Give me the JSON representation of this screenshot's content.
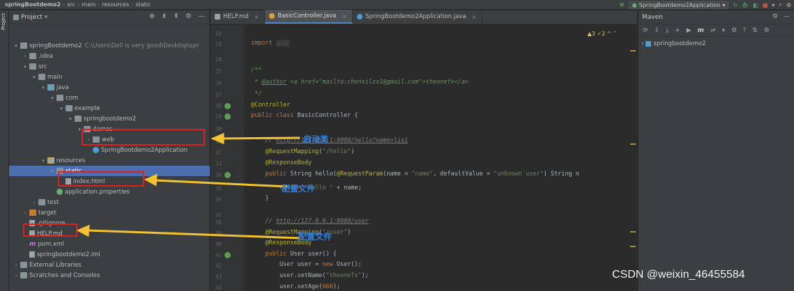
{
  "breadcrumb": [
    "springBootdemo2",
    "src",
    "main",
    "resources",
    "static"
  ],
  "run_config": "SpringBootdemo2Application",
  "left_strip_label": "Project",
  "project_panel": {
    "title": "Project",
    "tree": [
      {
        "label": "springBootdemo2",
        "hint": "C:\\Users\\Dell is very good\\Desktop\\spr",
        "arrow": "▾",
        "icon": "folder",
        "indent": 0
      },
      {
        "label": ".idea",
        "arrow": "›",
        "icon": "folder",
        "indent": 1
      },
      {
        "label": "src",
        "arrow": "▾",
        "icon": "folder",
        "indent": 1
      },
      {
        "label": "main",
        "arrow": "▾",
        "icon": "folder",
        "indent": 2
      },
      {
        "label": "java",
        "arrow": "▾",
        "icon": "folder-src",
        "indent": 3
      },
      {
        "label": "com",
        "arrow": "▾",
        "icon": "folder",
        "indent": 4
      },
      {
        "label": "example",
        "arrow": "▾",
        "icon": "folder",
        "indent": 5
      },
      {
        "label": "springbootdemo2",
        "arrow": "▾",
        "icon": "folder",
        "indent": 6
      },
      {
        "label": "demos",
        "arrow": "▾",
        "icon": "folder",
        "indent": 7
      },
      {
        "label": "web",
        "arrow": "›",
        "icon": "folder",
        "indent": 8
      },
      {
        "label": "SpringBootdemo2Application",
        "arrow": "",
        "icon": "app",
        "indent": 8
      },
      {
        "label": "resources",
        "arrow": "▾",
        "icon": "folder-res",
        "indent": 3
      },
      {
        "label": "static",
        "arrow": "▾",
        "icon": "folder",
        "indent": 4,
        "selected": true
      },
      {
        "label": "index.html",
        "arrow": "",
        "icon": "file",
        "indent": 5
      },
      {
        "label": "application.properties",
        "arrow": "",
        "icon": "spring",
        "indent": 4
      },
      {
        "label": "test",
        "arrow": "›",
        "icon": "folder",
        "indent": 2
      },
      {
        "label": "target",
        "arrow": "›",
        "icon": "folder-target",
        "indent": 1
      },
      {
        "label": ".gitignore",
        "arrow": "",
        "icon": "file",
        "indent": 1
      },
      {
        "label": "HELP.md",
        "arrow": "",
        "icon": "file",
        "indent": 1
      },
      {
        "label": "pom.xml",
        "arrow": "",
        "icon": "xml",
        "indent": 1
      },
      {
        "label": "springbootdemo2.iml",
        "arrow": "",
        "icon": "file",
        "indent": 1
      },
      {
        "label": "External Libraries",
        "arrow": "›",
        "icon": "folder",
        "indent": 0
      },
      {
        "label": "Scratches and Consoles",
        "arrow": "›",
        "icon": "folder",
        "indent": 0
      }
    ]
  },
  "editor": {
    "tabs": [
      {
        "label": "HELP.md",
        "active": false
      },
      {
        "label": "BasicController.java",
        "active": true
      },
      {
        "label": "SpringBootdemo2Application.java",
        "active": false
      }
    ],
    "inspection": "▲3  ✓2  ^  ˅",
    "lines": [
      {
        "num": "18",
        "html": ""
      },
      {
        "num": "19",
        "html": "<span class=\"kw\">import</span> <span class=\"fold\">...</span>"
      },
      {
        "num": "24",
        "html": ""
      },
      {
        "num": "25",
        "html": "<span class=\"cmt\">/**</span>"
      },
      {
        "num": "26",
        "html": "<span class=\"cmt\"> * <u>@author</u> &lt;a href=\"mailto:chenxilzx1@gmail.com\"&gt;theonefx&lt;/a&gt;</span>"
      },
      {
        "num": "27",
        "html": "<span class=\"cmt\"> */</span>"
      },
      {
        "num": "28",
        "html": "<span class=\"ann\">@Controller</span>"
      },
      {
        "num": "29",
        "html": "<span class=\"kw\">public class</span> BasicController {"
      },
      {
        "num": "30",
        "html": ""
      },
      {
        "num": "31",
        "html": "    <span class=\"cmt\">// <span class=\"lnk\">http://127.0.0.1:8080/hello?name=lisi</span></span>"
      },
      {
        "num": "32",
        "html": "    <span class=\"ann\">@RequestMapping</span>(<span class=\"str\">\"/hello\"</span>)"
      },
      {
        "num": "33",
        "html": "    <span class=\"ann\">@ResponseBody</span>"
      },
      {
        "num": "34",
        "html": "    <span class=\"kw\">public</span> String hello(<span class=\"ann\">@RequestParam</span>(name = <span class=\"str\">\"name\"</span>, defaultValue = <span class=\"str\">\"unknown user\"</span>) String n"
      },
      {
        "num": "35",
        "html": "        <span class=\"kw\">return</span> <span class=\"str\">\"Hello \"</span> + name;"
      },
      {
        "num": "36",
        "html": "    }"
      },
      {
        "num": "37",
        "html": ""
      },
      {
        "num": "38",
        "html": "    <span class=\"cmt\">// <span class=\"lnk\">http://127.0.0.1:8080/user</span></span>"
      },
      {
        "num": "39",
        "html": "    <span class=\"ann\">@RequestMapping</span>(<span class=\"str\">\"/user\"</span>)"
      },
      {
        "num": "40",
        "html": "    <span class=\"ann\">@ResponseBody</span>"
      },
      {
        "num": "41",
        "html": "    <span class=\"kw\">public</span> User user() {"
      },
      {
        "num": "42",
        "html": "        User user = <span class=\"kw\">new</span> User();"
      },
      {
        "num": "43",
        "html": "        user.setName(<span class=\"str\">\"theonefx\"</span>);"
      },
      {
        "num": "44",
        "html": "        user.setAge(<span class=\"kw\">666</span>);"
      }
    ]
  },
  "annotations": [
    {
      "label": "启动类"
    },
    {
      "label": "配置文件"
    },
    {
      "label": "配置文件"
    }
  ],
  "maven": {
    "title": "Maven",
    "toolbar": [
      "⟳",
      "⇩",
      "⤓",
      "+",
      "▶",
      "m",
      "⇌",
      "⏸",
      "⚙",
      "⤒",
      "⇅",
      "⚙"
    ],
    "tree": [
      {
        "label": "springbootdemo2",
        "arrow": "›"
      }
    ]
  },
  "watermark": "CSDN @weixin_46455584",
  "colors": {
    "accent": "#4a88c7",
    "selection": "#4b6eaf",
    "highlight_box": "#e02020",
    "arrow": "#f2c230",
    "annotation_text": "#2f7fe0"
  }
}
